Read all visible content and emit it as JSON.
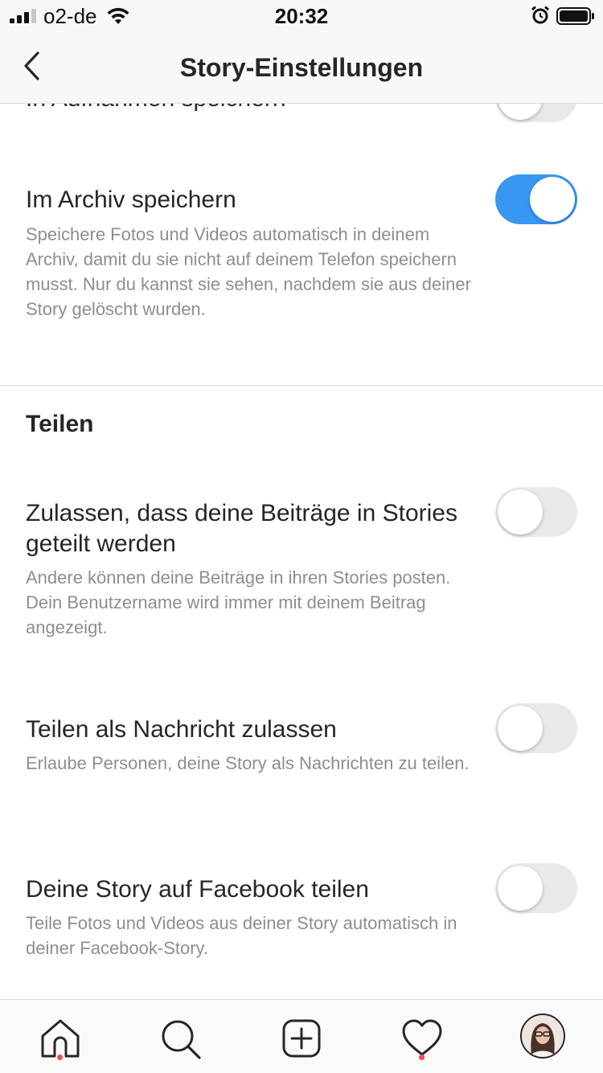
{
  "status_bar": {
    "carrier": "o2-de",
    "time": "20:32",
    "icons": [
      "signal-bars-icon",
      "wifi-icon",
      "alarm-clock-icon",
      "battery-icon"
    ]
  },
  "header": {
    "title": "Story-Einstellungen",
    "back_icon": "chevron-left-icon"
  },
  "settings": {
    "partial_row": {
      "label": "In Aufnahmen speichern",
      "enabled": false
    },
    "archive": {
      "label": "Im Archiv speichern",
      "description": "Speichere Fotos und Videos automatisch in deinem Archiv, damit du sie nicht auf deinem Telefon speichern musst. Nur du kannst sie sehen, nachdem sie aus deiner Story gelöscht wurden.",
      "enabled": true
    },
    "sharing_section": {
      "title": "Teilen",
      "items": [
        {
          "label": "Zulassen, dass deine Beiträge in Stories geteilt werden",
          "description": "Andere können deine Beiträge in ihren Stories posten. Dein Benutzername wird immer mit deinem Beitrag angezeigt.",
          "enabled": false
        },
        {
          "label": "Teilen als Nachricht zulassen",
          "description": "Erlaube Personen, deine Story als Nachrichten zu teilen.",
          "enabled": false
        },
        {
          "label": "Deine Story auf Facebook teilen",
          "description": "Teile Fotos und Videos aus deiner Story automatisch in deiner Facebook-Story.",
          "enabled": false
        }
      ]
    }
  },
  "tab_bar": {
    "tabs": [
      {
        "icon": "home-icon",
        "notification_dot": true
      },
      {
        "icon": "search-icon",
        "notification_dot": false
      },
      {
        "icon": "add-post-icon",
        "notification_dot": false
      },
      {
        "icon": "heart-icon",
        "notification_dot": true
      },
      {
        "icon": "profile-avatar",
        "notification_dot": false
      }
    ]
  },
  "colors": {
    "accent": "#3897f0",
    "toggle_off": "#e9e9eb",
    "notification_dot": "#ed4956",
    "secondary_text": "#8e8e8e",
    "primary_text": "#262626"
  }
}
